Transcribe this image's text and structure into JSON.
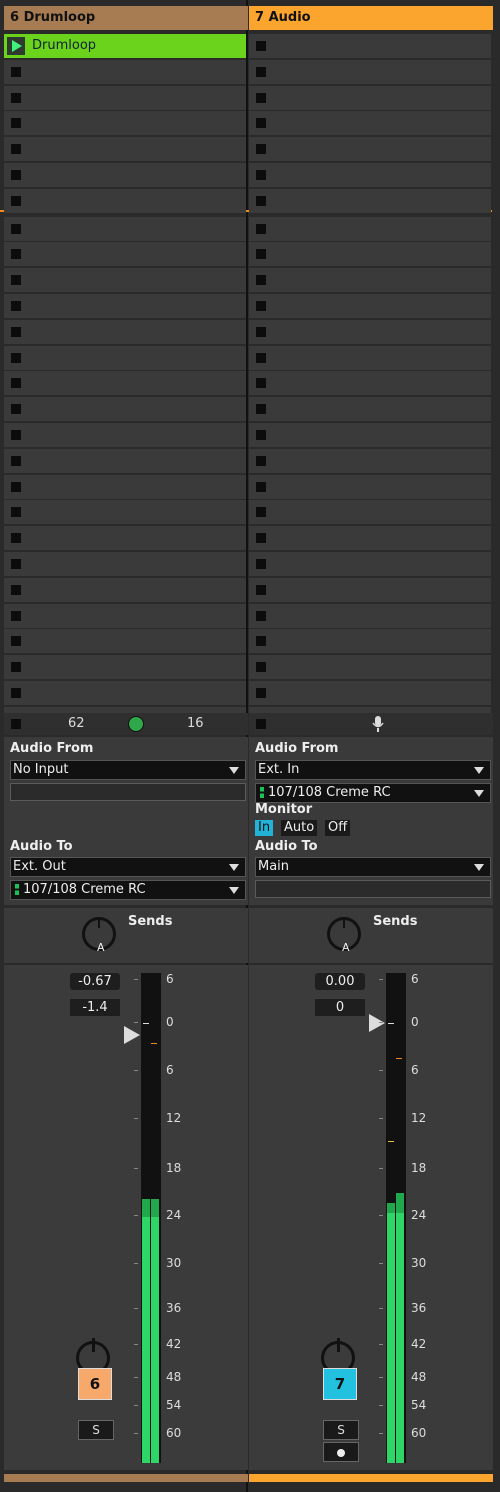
{
  "tracks": [
    {
      "name": "6 Drumloop",
      "header_color": "#a77c53",
      "clip": {
        "name": "Drumloop",
        "color": "#6bd31b"
      },
      "status": {
        "left_value": "62",
        "right_value": "16",
        "indicator": "green-circle-icon"
      },
      "audio_from": {
        "label": "Audio From",
        "value": "No Input"
      },
      "audio_to": {
        "label": "Audio To",
        "value": "Ext. Out",
        "output": "107/108 Creme RC"
      },
      "sends": {
        "label": "Sends",
        "knob": "A"
      },
      "volume": "-0.67",
      "peak": "-1.4",
      "track_number": "6",
      "number_color": "#f6a96a",
      "solo": "S",
      "meter_level_db": -24
    },
    {
      "name": "7 Audio",
      "header_color": "#fba52e",
      "status": {
        "indicator": "microphone-icon"
      },
      "audio_from": {
        "label": "Audio From",
        "value": "Ext. In",
        "input": "107/108 Creme RC"
      },
      "monitor": {
        "label": "Monitor",
        "options": [
          "In",
          "Auto",
          "Off"
        ],
        "selected": "In"
      },
      "audio_to": {
        "label": "Audio To",
        "value": "Main"
      },
      "sends": {
        "label": "Sends",
        "knob": "A"
      },
      "volume": "0.00",
      "peak": "0",
      "track_number": "7",
      "number_color": "#22c1df",
      "solo": "S",
      "meter_level_db": -24
    }
  ],
  "meter_scale": [
    "6",
    "0",
    "6",
    "12",
    "18",
    "24",
    "30",
    "36",
    "42",
    "48",
    "54",
    "60"
  ]
}
